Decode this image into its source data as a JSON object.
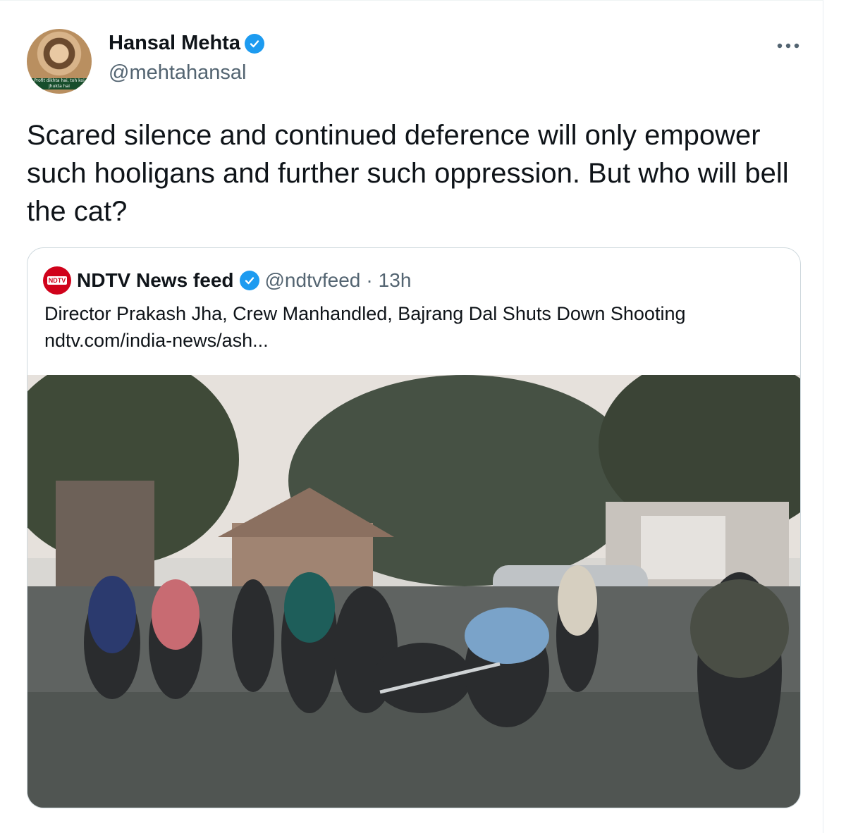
{
  "tweet": {
    "author": {
      "display_name": "Hansal Mehta",
      "handle": "@mehtahansal",
      "avatar_caption": "Profit dikhta hai, toh koi jhukta hai",
      "verified": true
    },
    "more_icon": "more-horizontal-icon",
    "text": "Scared silence and continued deference will only empower such hooligans and further such oppression. But who will bell the cat?"
  },
  "quoted_tweet": {
    "author": {
      "display_name": "NDTV News feed",
      "handle": "@ndtvfeed",
      "logo_text": "NDTV",
      "verified": true
    },
    "separator": "·",
    "time": "13h",
    "text_line1": "Director Prakash Jha, Crew Manhandled, Bajrang Dal Shuts Down Shooting",
    "text_line2": "ndtv.com/india-news/ash..."
  },
  "colors": {
    "verified_badge": "#1d9bf0",
    "ndtv_red": "#d0021b",
    "secondary_text": "#536471",
    "border": "#cfd9de"
  }
}
